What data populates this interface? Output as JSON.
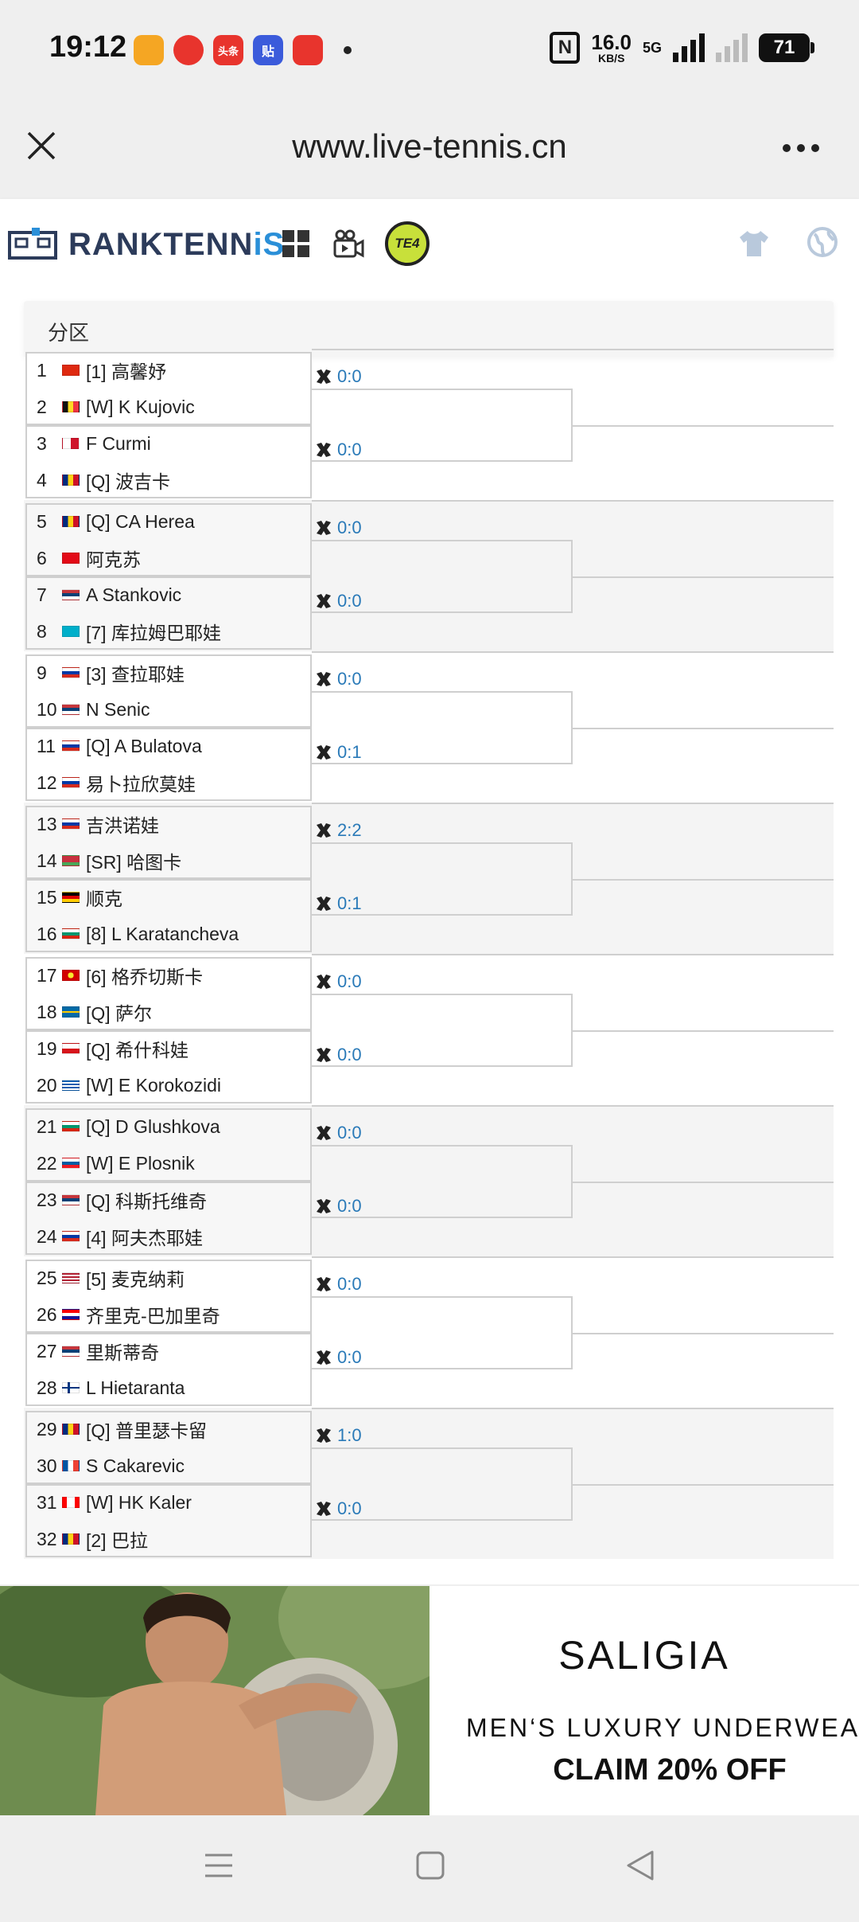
{
  "status_bar": {
    "time": "19:12",
    "speed_value": "16.0",
    "speed_unit": "KB/S",
    "network": "5G",
    "battery": "71",
    "apps": [
      {
        "icon": "weibo-icon",
        "color": "#f5a623",
        "label": ""
      },
      {
        "icon": "video-app-icon",
        "color": "#e8342d",
        "label": ""
      },
      {
        "icon": "toutiao-icon",
        "color": "#e8342d",
        "label": "头条"
      },
      {
        "icon": "tieba-icon",
        "color": "#3b5bdb",
        "label": "贴"
      },
      {
        "icon": "heart-app-icon",
        "color": "#e8342d",
        "label": ""
      }
    ]
  },
  "browser": {
    "url": "www.live-tennis.cn"
  },
  "site": {
    "logo_main": "RANKTENN",
    "logo_accent": "iS",
    "te4_label": "TE4"
  },
  "draw": {
    "section_title": "分区",
    "matches": [
      {
        "p1": {
          "num": "1",
          "flag": "cn",
          "name": "[1] 高馨妤"
        },
        "p2": {
          "num": "2",
          "flag": "be",
          "name": "[W] K Kujovic"
        },
        "score": "0:0"
      },
      {
        "p1": {
          "num": "3",
          "flag": "mt",
          "name": "F Curmi"
        },
        "p2": {
          "num": "4",
          "flag": "ro",
          "name": "[Q] 波吉卡"
        },
        "score": "0:0"
      },
      {
        "p1": {
          "num": "5",
          "flag": "ro",
          "name": "[Q] CA Herea"
        },
        "p2": {
          "num": "6",
          "flag": "tr",
          "name": "阿克苏"
        },
        "score": "0:0"
      },
      {
        "p1": {
          "num": "7",
          "flag": "rs",
          "name": "A Stankovic"
        },
        "p2": {
          "num": "8",
          "flag": "kz",
          "name": "[7] 库拉姆巴耶娃"
        },
        "score": "0:0"
      },
      {
        "p1": {
          "num": "9",
          "flag": "ru",
          "name": "[3] 查拉耶娃"
        },
        "p2": {
          "num": "10",
          "flag": "rs",
          "name": "N Senic"
        },
        "score": "0:0"
      },
      {
        "p1": {
          "num": "11",
          "flag": "ru",
          "name": "[Q] A Bulatova"
        },
        "p2": {
          "num": "12",
          "flag": "ru",
          "name": "易卜拉欣莫娃"
        },
        "score": "0:1"
      },
      {
        "p1": {
          "num": "13",
          "flag": "ru",
          "name": "吉洪诺娃"
        },
        "p2": {
          "num": "14",
          "flag": "by",
          "name": "[SR] 哈图卡"
        },
        "score": "2:2"
      },
      {
        "p1": {
          "num": "15",
          "flag": "de",
          "name": "顺克"
        },
        "p2": {
          "num": "16",
          "flag": "bg",
          "name": "[8] L Karatancheva"
        },
        "score": "0:1"
      },
      {
        "p1": {
          "num": "17",
          "flag": "mk",
          "name": "[6] 格乔切斯卡"
        },
        "p2": {
          "num": "18",
          "flag": "se",
          "name": "[Q] 萨尔"
        },
        "score": "0:0"
      },
      {
        "p1": {
          "num": "19",
          "flag": "cz",
          "name": "[Q] 希什科娃"
        },
        "p2": {
          "num": "20",
          "flag": "gr",
          "name": "[W] E Korokozidi"
        },
        "score": "0:0"
      },
      {
        "p1": {
          "num": "21",
          "flag": "bg",
          "name": "[Q] D Glushkova"
        },
        "p2": {
          "num": "22",
          "flag": "si",
          "name": "[W] E Plosnik"
        },
        "score": "0:0"
      },
      {
        "p1": {
          "num": "23",
          "flag": "rs",
          "name": "[Q] 科斯托维奇"
        },
        "p2": {
          "num": "24",
          "flag": "ru",
          "name": "[4] 阿夫杰耶娃"
        },
        "score": "0:0"
      },
      {
        "p1": {
          "num": "25",
          "flag": "us",
          "name": "[5] 麦克纳莉"
        },
        "p2": {
          "num": "26",
          "flag": "hr",
          "name": "齐里克-巴加里奇"
        },
        "score": "0:0"
      },
      {
        "p1": {
          "num": "27",
          "flag": "rs",
          "name": "里斯蒂奇"
        },
        "p2": {
          "num": "28",
          "flag": "fi",
          "name": "L Hietaranta"
        },
        "score": "0:0"
      },
      {
        "p1": {
          "num": "29",
          "flag": "ro",
          "name": "[Q] 普里瑟卡留"
        },
        "p2": {
          "num": "30",
          "flag": "fr",
          "name": "S Cakarevic"
        },
        "score": "1:0"
      },
      {
        "p1": {
          "num": "31",
          "flag": "ca",
          "name": "[W] HK Kaler"
        },
        "p2": {
          "num": "32",
          "flag": "ro",
          "name": "[2] 巴拉"
        },
        "score": "0:0"
      }
    ]
  },
  "ad": {
    "brand": "SALIGIA",
    "line": "MEN‘S LUXURY UNDERWEAR",
    "cta": "CLAIM 20% OFF"
  },
  "colors": {
    "score_blue": "#2a7ab8",
    "logo_dark": "#2c3b5a",
    "logo_accent": "#2a8fd8",
    "te4_yellow": "#c8e03a"
  }
}
